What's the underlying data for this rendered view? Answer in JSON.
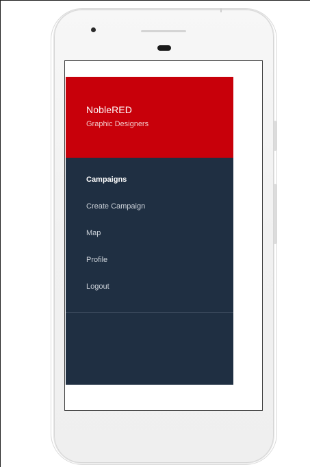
{
  "drawer": {
    "header": {
      "title": "NobleRED",
      "subtitle": "Graphic Designers"
    },
    "items": [
      {
        "label": "Campaigns",
        "active": true
      },
      {
        "label": "Create Campaign",
        "active": false
      },
      {
        "label": "Map",
        "active": false
      },
      {
        "label": "Profile",
        "active": false
      },
      {
        "label": "Logout",
        "active": false
      }
    ]
  },
  "colors": {
    "header_bg": "#c8000a",
    "drawer_bg": "#1f2f42",
    "phone_body": "#f2f2f2"
  }
}
